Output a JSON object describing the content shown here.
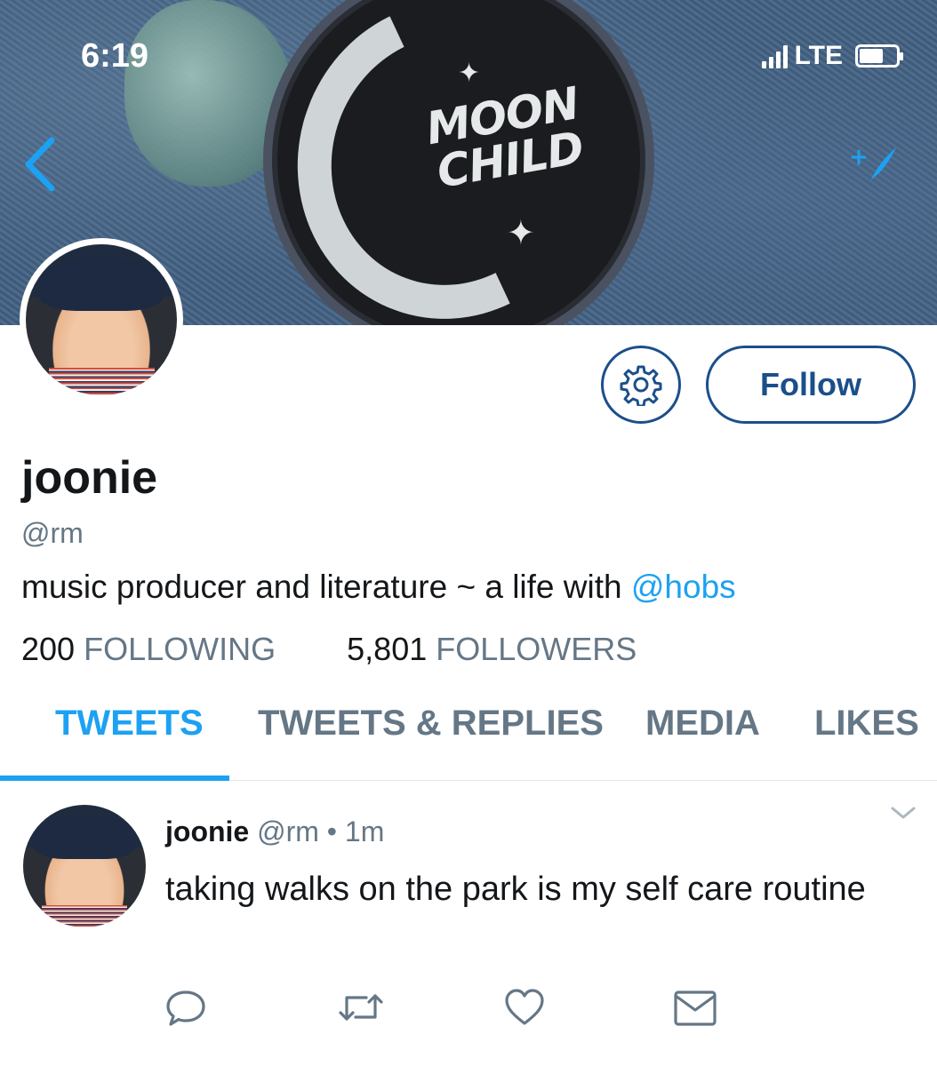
{
  "status_bar": {
    "time": "6:19",
    "network": "LTE"
  },
  "banner": {
    "patch_text_line1": "MOON",
    "patch_text_line2": "CHILD",
    "star1": "✦",
    "star2": "✦"
  },
  "colors": {
    "accent": "#1da1f2",
    "button_border": "#1b4f8a",
    "muted": "#657786"
  },
  "profile": {
    "display_name": "joonie",
    "handle": "@rm",
    "bio_text": "music producer and literature ~ a life with ",
    "bio_mention": "@hobs",
    "following_count": "200",
    "following_label": "FOLLOWING",
    "followers_count": "5,801",
    "followers_label": "FOLLOWERS"
  },
  "buttons": {
    "follow_label": "Follow",
    "settings_icon": "gear-icon",
    "back_icon": "chevron-left-icon",
    "compose_icon": "compose-feather-icon"
  },
  "tabs": [
    {
      "label": "TWEETS",
      "active": true
    },
    {
      "label": "TWEETS & REPLIES",
      "active": false
    },
    {
      "label": "MEDIA",
      "active": false
    },
    {
      "label": "LIKES",
      "active": false
    }
  ],
  "tweet": {
    "name": "joonie",
    "handle": "@rm",
    "separator": "•",
    "time": "1m",
    "text": "taking walks on the park is my self care routine",
    "actions": [
      "reply-icon",
      "retweet-icon",
      "like-icon",
      "dm-icon"
    ]
  }
}
